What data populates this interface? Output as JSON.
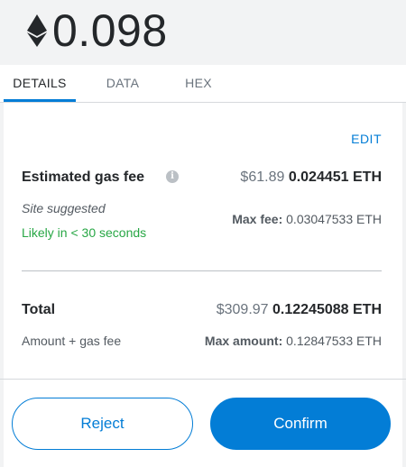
{
  "header": {
    "amount": "0.098",
    "currency_icon": "ethereum-icon"
  },
  "tabs": [
    {
      "label": "DETAILS",
      "active": true
    },
    {
      "label": "DATA",
      "active": false
    },
    {
      "label": "HEX",
      "active": false
    }
  ],
  "details": {
    "edit_label": "EDIT",
    "gas": {
      "label": "Estimated gas fee",
      "info_icon": "info-icon",
      "fiat": "$61.89",
      "eth": "0.024451 ETH",
      "site_suggested": "Site suggested",
      "likely": "Likely in < 30 seconds",
      "max_fee_label": "Max fee:",
      "max_fee_value": "0.03047533 ETH"
    },
    "total": {
      "label": "Total",
      "fiat": "$309.97",
      "eth": "0.12245088 ETH",
      "sub_label": "Amount + gas fee",
      "max_amount_label": "Max amount:",
      "max_amount_value": "0.12847533 ETH"
    }
  },
  "actions": {
    "reject_label": "Reject",
    "confirm_label": "Confirm"
  },
  "colors": {
    "accent": "#037dd6",
    "success": "#28a745",
    "header_bg": "#f2f3f4"
  }
}
